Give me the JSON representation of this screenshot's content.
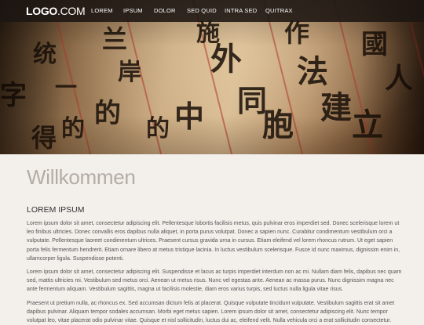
{
  "header": {
    "logo_bold": "LOGO",
    "logo_suffix": ".COM",
    "nav": [
      {
        "label": "LOREM"
      },
      {
        "label": "IPSUM"
      },
      {
        "label": "DOLOR"
      },
      {
        "label": "SED QUID"
      },
      {
        "label": "INTRA SED"
      },
      {
        "label": "QUITRAX"
      }
    ]
  },
  "hero": {
    "characters": [
      "字",
      "统",
      "一",
      "的",
      "兰",
      "岸",
      "得",
      "的",
      "中",
      "外",
      "同",
      "施",
      "作",
      "法",
      "國",
      "人",
      "建",
      "立",
      "胞",
      "的"
    ]
  },
  "main": {
    "title": "Willkommen",
    "subtitle": "LOREM IPSUM",
    "paragraphs": [
      "Lorem ipsum dolor sit amet, consectetur adipiscing elit. Pellentesque lobortis facilisis metus, quis pulvinar eros imperdiet sed. Donec scelerisque lorem ut leo finibus ultricies. Donec convallis eros dapibus nulla aliquet, in porta purus volutpat. Donec a sapien nunc. Curabitur condimentum vestibulum orci a vulputate. Pellentesque laoreet condimentum ultrices. Praesent cursus gravida urna in cursus. Etiam eleifend vel lorem rhoncus rutrum. Ut eget sapien porta felis fermentum hendrerit. Etiam ornare libero at metus tristique lacinia. In luctus vestibulum scelerisque. Fusce id nunc maximus, dignissim enim in, ullamcorper ligula. Suspendisse potenti.",
      "Lorem ipsum dolor sit amet, consectetur adipiscing elit. Suspendisse et lacus ac turpis imperdiet interdum non ac mi. Nullam diam felis, dapibus nec quam sed, mattis ultricies mi. Vestibulum sed metus orci. Aenean ut metus risus. Nunc vel egestas ante. Aenean ac massa purus. Nunc dignissim magna nec ante fermentum aliquam. Vestibulum sagittis, magna ut facilisis molestie, diam eros varius turpis, sed luctus nulla ligula vitae risus.",
      "Praesent ut pretium nulla, ac rhoncus ex. Sed accumsan dictum felis at placerat. Quisque vulputate tincidunt vulputate. Vestibulum sagittis erat sit amet dapibus pulvinar. Aliquam tempor sodales accumsan. Morbi eget metus sapien. Lorem ipsum dolor sit amet, consectetur adipiscing elit. Nunc tempor volutpat leo, vitae placerat odio pulvinar vitae. Quisque et nisl sollicitudin, luctus dui ac, eleifend velit. Nulla vehicula orci a erat sollicitudin consectetur."
    ]
  }
}
